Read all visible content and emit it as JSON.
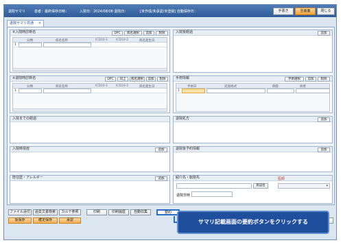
{
  "titlebar": {
    "app_name": "退院サマリ",
    "patient_info": "患者：最終保存日時：",
    "admission": "入院日：2024/08/08 退院日：",
    "status": "[未作成/未承認/未登録] 自動保存日：",
    "buttons": [
      "手書き",
      "全画面",
      "閉じる"
    ]
  },
  "tab": {
    "label": "退院サマリ共通",
    "close": "×"
  },
  "panels": {
    "admission_diagnosis": {
      "title": "※入院時診断名",
      "buttons": [
        "DPC",
        "病名選択",
        "追加",
        "削除"
      ],
      "columns": [
        "分類",
        "病名名称",
        "ICD10-1",
        "ICD10-2",
        "病名発生日"
      ],
      "row_marker": "1"
    },
    "hospital_course_top": {
      "title": "入院後経過",
      "button": "追加"
    },
    "discharge_diagnosis": {
      "title": "※退院時診断名",
      "buttons": [
        "DPC",
        "同上",
        "病名選択",
        "追加",
        "削除"
      ],
      "columns": [
        "分類",
        "病名名称",
        "ICD10-1",
        "ICD10-2",
        "病名発生日"
      ],
      "row_marker": "1"
    },
    "surgery": {
      "title": "手術情報",
      "buttons": [
        "手術選択",
        "追加",
        "削除"
      ],
      "columns": [
        "手術日",
        "実施術式",
        "麻酔",
        "術者"
      ],
      "row_marker": "1"
    },
    "admission_reason": {
      "title": "入院までの経過"
    },
    "discharge_prescription": {
      "title": "退院処方",
      "button": "追加"
    },
    "admission_history": {
      "title": "入院時現症",
      "button": "追加"
    },
    "post_discharge": {
      "title": "退院後予約情報",
      "button": "追加"
    },
    "allergy": {
      "title": "既往歴・アレルギー",
      "button": "追加"
    },
    "referral": {
      "title": "紹介先・転院先",
      "hospital_label": "施設名",
      "doctor_label": "医師",
      "date_label": "退院日時"
    }
  },
  "footer": {
    "row1": [
      "ファイル添付",
      "過去文書検索",
      "カルテ参照",
      "印刷",
      "印刷履歴",
      "自動収集",
      "要約"
    ],
    "row2": [
      "仮保存",
      "確定保存",
      "承認"
    ],
    "close": "閉じる"
  },
  "callout": {
    "text": "サマリ記載画面の要約ボタンをクリックする"
  }
}
